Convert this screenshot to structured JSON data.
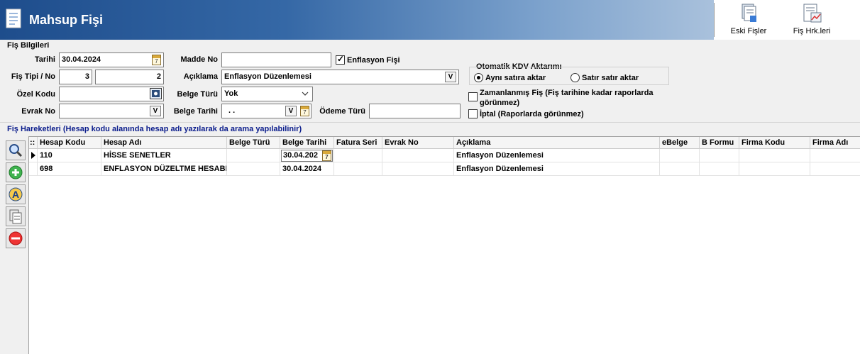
{
  "window": {
    "title": "Mahsup Fişi"
  },
  "toolbar": {
    "eski_fisler": "Eski Fişler",
    "fis_hrk": "Fiş Hrk.leri"
  },
  "form": {
    "section": "Fiş Bilgileri",
    "tarihi_label": "Tarihi",
    "tarihi_value": "30.04.2024",
    "fis_tipi_label": "Fiş Tipi / No",
    "fis_tipi_value": "3",
    "fis_no_value": "2",
    "ozel_kodu_label": "Özel Kodu",
    "ozel_kodu_value": "",
    "evrak_no_label": "Evrak No",
    "evrak_no_value": "",
    "madde_no_label": "Madde No",
    "madde_no_value": "",
    "enflasyon_label": "Enflasyon Fişi",
    "enflasyon_checked": true,
    "aciklama_label": "Açıklama",
    "aciklama_value": "Enflasyon Düzenlemesi",
    "belge_turu_label": "Belge Türü",
    "belge_turu_value": "Yok",
    "belge_tarihi_label": "Belge Tarihi",
    "belge_tarihi_value": ". .",
    "odeme_turu_label": "Ödeme Türü",
    "odeme_turu_value": "",
    "kdv_title": "Otomatik KDV Aktarımı",
    "kdv_option1": "Aynı satıra aktar",
    "kdv_option2": "Satır satır aktar",
    "zamanlanmis_line1": "Zamanlanmış Fiş (Fiş tarihine kadar raporlarda",
    "zamanlanmis_line2": "görünmez)",
    "iptal": "İptal (Raporlarda görünmez)",
    "v_glyph": "V",
    "cal_glyph": "7"
  },
  "grid": {
    "section": "Fiş Hareketleri (Hesap kodu alanında hesap adı yazılarak da arama yapılabilinir)",
    "corner": "::",
    "columns": [
      "Hesap Kodu",
      "Hesap Adı",
      "Belge Türü",
      "Belge Tarihi",
      "Fatura Seri",
      "Evrak No",
      "Açıklama",
      "eBelge",
      "B Formu",
      "Firma Kodu",
      "Firma Adı"
    ],
    "rows": [
      {
        "hesap_kodu": "110",
        "hesap_adi": "HİSSE SENETLER",
        "belge_turu": "",
        "belge_tarihi": "30.04.202",
        "fatura_seri": "",
        "evrak_no": "",
        "aciklama": "Enflasyon Düzenlemesi"
      },
      {
        "hesap_kodu": "698",
        "hesap_adi": "ENFLASYON DÜZELTME HESABI",
        "belge_turu": "",
        "belge_tarihi": "30.04.2024",
        "fatura_seri": "",
        "evrak_no": "",
        "aciklama": "Enflasyon Düzenlemesi"
      }
    ]
  },
  "side_tools": [
    "search-icon",
    "add-icon",
    "font-icon",
    "copy-icon",
    "delete-icon"
  ],
  "colors": {
    "header_dark": "#1e4d8c",
    "section_blue": "#0b1d8c"
  }
}
